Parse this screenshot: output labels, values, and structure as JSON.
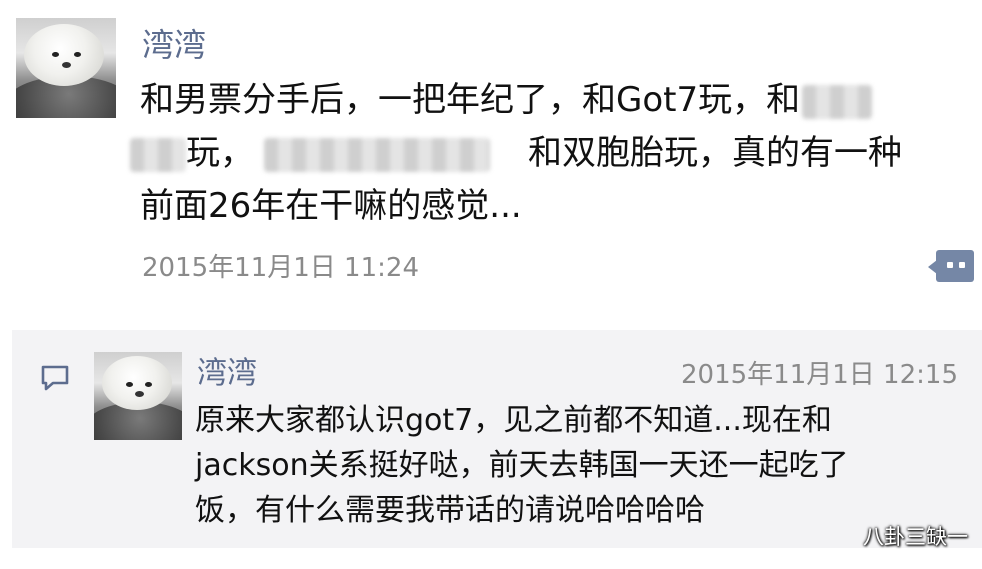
{
  "post": {
    "username": "湾湾",
    "message_lines": [
      "和男票分手后，一把年纪了，和Got7玩，和",
      "玩，",
      "和双胞胎玩，真的有一种",
      "前面26年在干嘛的感觉..."
    ],
    "timestamp": "2015年11月1日 11:24",
    "comment_button_icon": "comment-bubble-icon"
  },
  "comment": {
    "icon": "comment-icon",
    "username": "湾湾",
    "timestamp": "2015年11月1日 12:15",
    "message_lines": [
      "原来大家都认识got7，见之前都不知道...现在和",
      "jackson关系挺好哒，前天去韩国一天还一起吃了",
      "饭，有什么需要我带话的请说哈哈哈哈"
    ]
  },
  "watermark": "八卦三缺一",
  "colors": {
    "username": "#5c6c8e",
    "timestamp": "#8a8a8a",
    "comment_bg": "#f3f3f5",
    "button": "#7587a6"
  }
}
